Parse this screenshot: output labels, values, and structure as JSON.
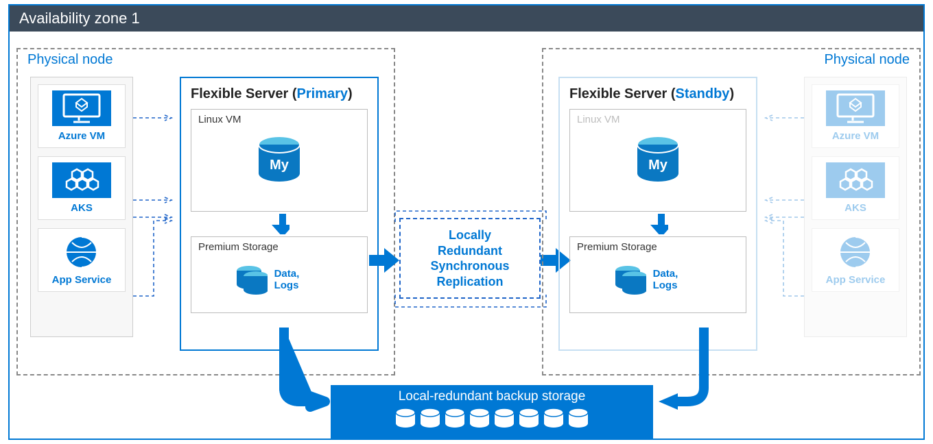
{
  "zone_title": "Availability zone 1",
  "physical_node_label": "Physical node",
  "services": {
    "vm": "Azure VM",
    "aks": "AKS",
    "app": "App Service"
  },
  "flexible_server": {
    "title_prefix": "Flexible Server (",
    "title_suffix": ")",
    "role_primary": "Primary",
    "role_standby": "Standby",
    "linux_vm": "Linux VM",
    "premium_storage": "Premium Storage",
    "data_logs": "Data, Logs",
    "db_badge": "My"
  },
  "replication": {
    "line1": "Locally",
    "line2": "Redundant",
    "line3": "Synchronous",
    "line4": "Replication"
  },
  "backup_storage": "Local-redundant backup storage"
}
